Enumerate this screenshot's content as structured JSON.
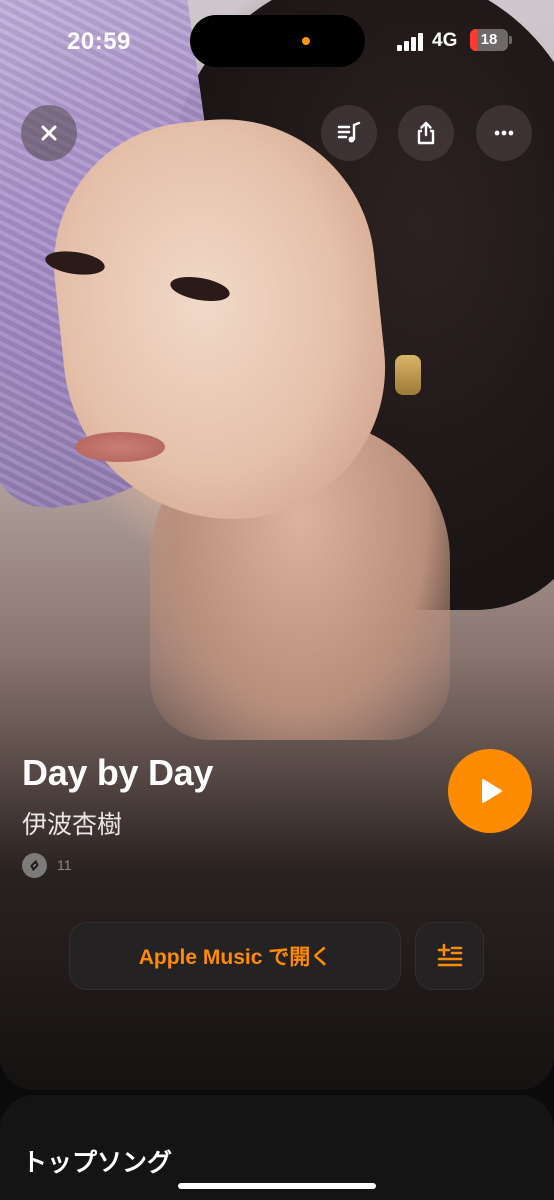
{
  "status_bar": {
    "time": "20:59",
    "network": "4G",
    "battery": "18",
    "battery_level": 0.18,
    "battery_color": "#ff3b30",
    "privacy_dot_color": "#ff9500"
  },
  "top_buttons": {
    "close_icon": "close-icon",
    "lyrics_icon": "music-note-list-icon",
    "share_icon": "share-icon",
    "more_icon": "ellipsis-icon"
  },
  "track": {
    "title": "Day by Day",
    "artist": "伊波杏樹",
    "shazam_count": "11"
  },
  "actions": {
    "play_icon": "play-icon",
    "open_apple_music_label": "Apple Music で開く",
    "queue_icon": "add-to-queue-icon"
  },
  "sheet": {
    "section_title": "トップソング"
  },
  "colors": {
    "accent": "#ff8c00",
    "background": "#0b0b0b",
    "button_bg": "#242222"
  }
}
